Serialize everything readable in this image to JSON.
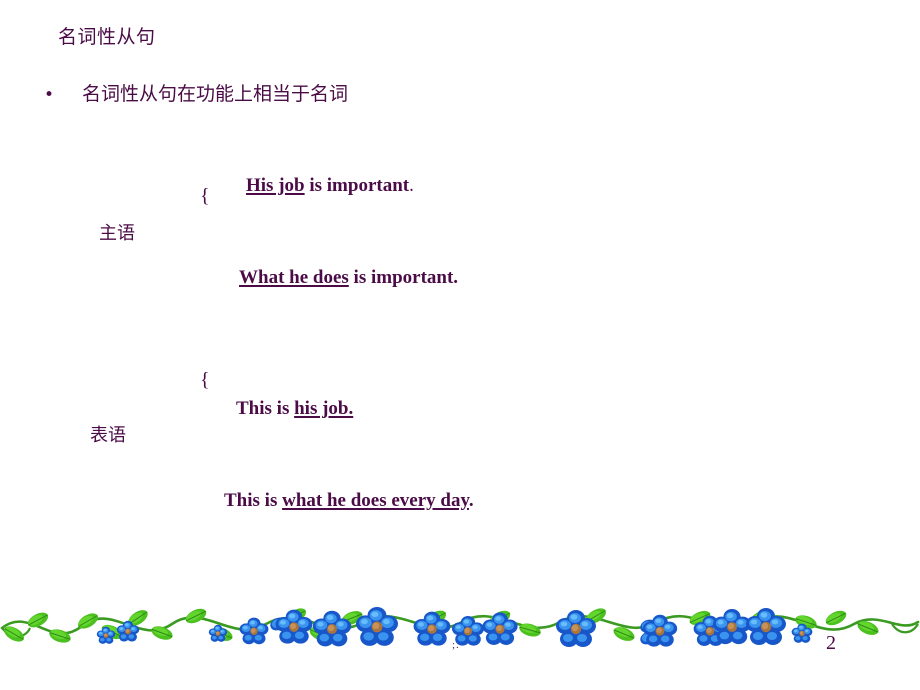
{
  "slide": {
    "title": "名词性从句",
    "page_number": "2",
    "stray_mark": ";.",
    "text_color": "#4a0b46",
    "background_color": "#ffffff"
  },
  "bullet": {
    "marker": "•",
    "text": "名词性从句在功能上相当于名词"
  },
  "groups": [
    {
      "id": "subject",
      "label": "主语",
      "brace": "{",
      "sentences": [
        {
          "underlined": "His job",
          "rest": " is important",
          "tail": "."
        },
        {
          "underlined": "What he does",
          "rest": " is important.",
          "tail": ""
        }
      ]
    },
    {
      "id": "predicative",
      "label": "表语",
      "brace": "{",
      "sentences": [
        {
          "lead": "This is ",
          "underlined": "his job.",
          "tail": ""
        },
        {
          "lead": "This is ",
          "underlined": "what he does every day",
          "tail": "."
        }
      ]
    }
  ],
  "decoration": {
    "border_name": "blue-flower-vine-border",
    "vine_color": "#3a9a22",
    "leaf_color": "#4cc01f",
    "flower_color": "#1c6fe0",
    "flower_highlight": "#4aa8f5",
    "flower_center": "#a9743d"
  }
}
